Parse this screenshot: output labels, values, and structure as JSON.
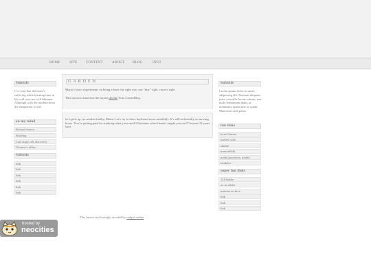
{
  "nav": {
    "items": [
      {
        "label": "HOME"
      },
      {
        "label": "SITE"
      },
      {
        "label": "CONTENT"
      },
      {
        "label": "ABOUT"
      },
      {
        "label": "BLOG"
      },
      {
        "label": "INFO"
      }
    ]
  },
  "left_sidebar": {
    "subtitle1": "Subtitle",
    "intro_text": "I’ve read that the brain’s suffering while learning time in life will save me of Alzheimer. Although with the modern news the temptation is real.",
    "on_my_mind_heading": "on my mind",
    "on_my_mind_items": [
      {
        "label": "Roman history"
      },
      {
        "label": "Reading"
      },
      {
        "label": "Late stage self discovery"
      },
      {
        "label": "Ukraine’s allies"
      }
    ],
    "subtitle2": "Subtitle",
    "links": [
      {
        "label": "link"
      },
      {
        "label": "link"
      },
      {
        "label": "link"
      },
      {
        "label": "link"
      },
      {
        "label": "link"
      },
      {
        "label": "link"
      }
    ]
  },
  "main": {
    "title": "GARDEN",
    "intro_line": "Maria’s basic experiments on being a basic the right way. use “that” right. correct right",
    "credit_prefix": "This layout is based on the layout",
    "credit_link": "skyline",
    "credit_suffix": "from CrustoBlog.",
    "body_text": "let’s pick up yet another hobby, Maria. Let’s try to draw keyboard more mindfully. It’s still technically on moving hours. You’re getting paid for studying what your small Ukrainian school hadn’t taught you on IT lessons 12 years later"
  },
  "right_sidebar": {
    "subtitle": "Subtitle",
    "lorem_text": "Lorem ipsum dolor sit amet, adipiscing elit. Praesent aliquam, justo convallis luctus rutrum, erat nulla fermentum diam, at nonummy quam ante ac quam. Maecenas urna purus.",
    "fun_links_heading": "fun links",
    "fun_links": [
      {
        "label": "bored button"
      },
      {
        "label": "useless web"
      },
      {
        "label": "skuhle"
      },
      {
        "label": "masterWiki"
      },
      {
        "label": "math (pun-keys, maths!"
      },
      {
        "label": "latakilor"
      }
    ],
    "super_fun_heading": "super fun links",
    "super_fun_links": [
      {
        "label": "128 ladder"
      },
      {
        "label": "no to adobe"
      },
      {
        "label": "internet archive"
      },
      {
        "label": "link"
      },
      {
        "label": "link"
      },
      {
        "label": "link"
      }
    ]
  },
  "footer": {
    "prefix": "This layout was lovingly recoded by",
    "link": "sadgirl.online"
  },
  "badge": {
    "hosted_by": "hosted by",
    "brand": "neocities"
  },
  "colors": {
    "banner": "#f2f2f2",
    "navbar": "#ebebeb",
    "box": "#f4f4f4",
    "badge": "#9a9a9a"
  }
}
